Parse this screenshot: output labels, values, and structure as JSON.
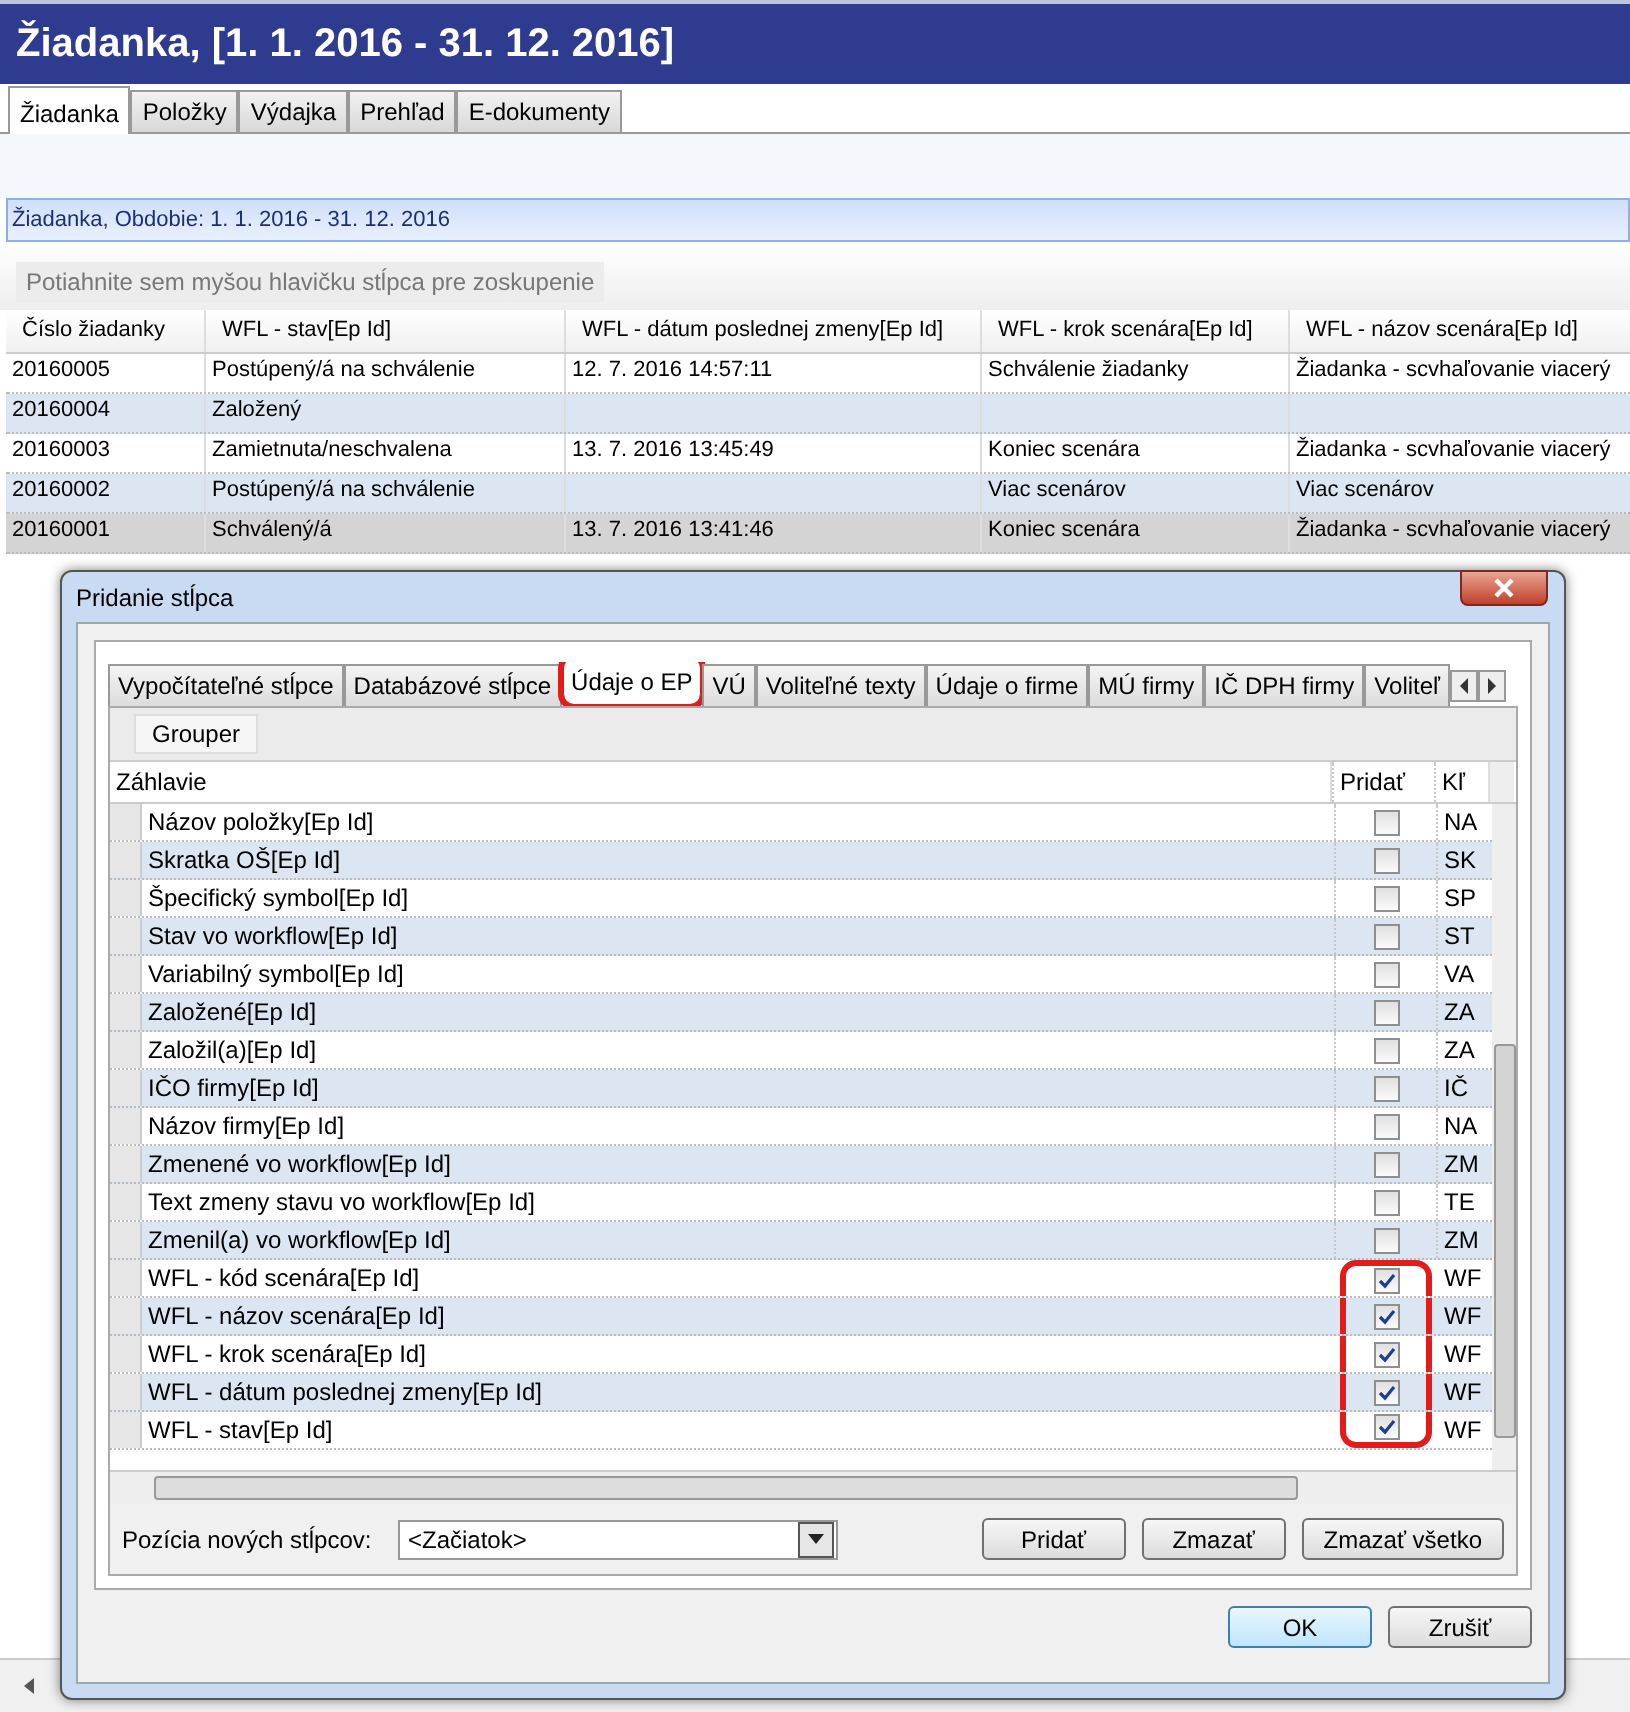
{
  "window": {
    "title": "Žiadanka,  [1. 1. 2016 - 31. 12. 2016]"
  },
  "tabs": [
    {
      "label": "Žiadanka",
      "selected": true
    },
    {
      "label": "Položky",
      "selected": false
    },
    {
      "label": "Výdajka",
      "selected": false
    },
    {
      "label": "Prehľad",
      "selected": false
    },
    {
      "label": "E-dokumenty",
      "selected": false
    }
  ],
  "group_header": "Žiadanka, Obdobie: 1. 1. 2016 - 31. 12. 2016",
  "group_panel": {
    "placeholder": "Potiahnite sem myšou hlavičku stĺpca pre zoskupenie"
  },
  "table": {
    "columns": [
      "Číslo žiadanky",
      "WFL - stav[Ep Id]",
      "WFL - dátum poslednej zmeny[Ep Id]",
      "WFL - krok scenára[Ep Id]",
      "WFL - názov scenára[Ep Id]"
    ],
    "rows": [
      {
        "cells": [
          "20160005",
          "Postúpený/á na schválenie",
          "12. 7. 2016 14:57:11",
          "Schválenie žiadanky",
          "Žiadanka - scvhaľovanie viacerý"
        ],
        "selected": false
      },
      {
        "cells": [
          "20160004",
          "Založený",
          "",
          "",
          ""
        ],
        "selected": false
      },
      {
        "cells": [
          "20160003",
          "Zamietnuta/neschvalena",
          "13. 7. 2016 13:45:49",
          "Koniec scenára",
          "Žiadanka - scvhaľovanie viacerý"
        ],
        "selected": false
      },
      {
        "cells": [
          "20160002",
          "Postúpený/á na schválenie",
          "",
          "Viac scenárov",
          "Viac scenárov"
        ],
        "selected": false
      },
      {
        "cells": [
          "20160001",
          "Schválený/á",
          "13. 7. 2016 13:41:46",
          "Koniec scenára",
          "Žiadanka - scvhaľovanie viacerý"
        ],
        "selected": true
      }
    ]
  },
  "dialog": {
    "title": "Pridanie stĺpca",
    "tabs": [
      {
        "label": "Vypočítateľné stĺpce",
        "selected": false,
        "highlighted": false
      },
      {
        "label": "Databázové stĺpce",
        "selected": false,
        "highlighted": false
      },
      {
        "label": "Údaje o EP",
        "selected": true,
        "highlighted": true
      },
      {
        "label": "VÚ",
        "selected": false,
        "highlighted": false
      },
      {
        "label": "Voliteľné texty",
        "selected": false,
        "highlighted": false
      },
      {
        "label": "Údaje o firme",
        "selected": false,
        "highlighted": false
      },
      {
        "label": "MÚ firmy",
        "selected": false,
        "highlighted": false
      },
      {
        "label": "IČ DPH firmy",
        "selected": false,
        "highlighted": false
      },
      {
        "label": "Voliteľ",
        "selected": false,
        "highlighted": false
      }
    ],
    "grouper": "Grouper",
    "columns": [
      "Záhlavie",
      "Pridať",
      "Kľ"
    ],
    "rows": [
      {
        "name": "Názov položky[Ep Id]",
        "checked": false,
        "key": "NA",
        "highlighted": false
      },
      {
        "name": "Skratka OŠ[Ep Id]",
        "checked": false,
        "key": "SK",
        "highlighted": false
      },
      {
        "name": "Špecifický symbol[Ep Id]",
        "checked": false,
        "key": "SP",
        "highlighted": false
      },
      {
        "name": "Stav vo workflow[Ep Id]",
        "checked": false,
        "key": "ST",
        "highlighted": false
      },
      {
        "name": "Variabilný symbol[Ep Id]",
        "checked": false,
        "key": "VA",
        "highlighted": false
      },
      {
        "name": "Založené[Ep Id]",
        "checked": false,
        "key": "ZA",
        "highlighted": false
      },
      {
        "name": "Založil(a)[Ep Id]",
        "checked": false,
        "key": "ZA",
        "highlighted": false
      },
      {
        "name": "IČO firmy[Ep Id]",
        "checked": false,
        "key": "IČ",
        "highlighted": false
      },
      {
        "name": "Názov firmy[Ep Id]",
        "checked": false,
        "key": "NA",
        "highlighted": false
      },
      {
        "name": "Zmenené vo workflow[Ep Id]",
        "checked": false,
        "key": "ZM",
        "highlighted": false
      },
      {
        "name": "Text zmeny stavu vo workflow[Ep Id]",
        "checked": false,
        "key": "TE",
        "highlighted": false
      },
      {
        "name": "Zmenil(a) vo workflow[Ep Id]",
        "checked": false,
        "key": "ZM",
        "highlighted": false
      },
      {
        "name": "WFL - kód scenára[Ep Id]",
        "checked": true,
        "key": "WF",
        "highlighted": true
      },
      {
        "name": "WFL - názov scenára[Ep Id]",
        "checked": true,
        "key": "WF",
        "highlighted": true
      },
      {
        "name": "WFL - krok scenára[Ep Id]",
        "checked": true,
        "key": "WF",
        "highlighted": true
      },
      {
        "name": "WFL - dátum poslednej zmeny[Ep Id]",
        "checked": true,
        "key": "WF",
        "highlighted": true
      },
      {
        "name": "WFL - stav[Ep Id]",
        "checked": true,
        "key": "WF",
        "highlighted": true
      }
    ],
    "position_label": "Pozícia nových stĺpcov:",
    "position_value": "<Začiatok>",
    "action_buttons": [
      "Pridať",
      "Zmazať",
      "Zmazať všetko"
    ],
    "buttons": [
      "OK",
      "Zrušiť"
    ]
  }
}
